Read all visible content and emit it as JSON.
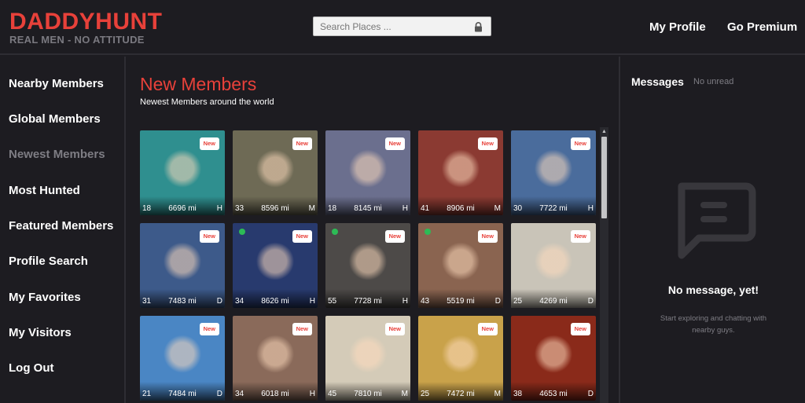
{
  "header": {
    "logo": "DADDYHUNT",
    "tagline": "REAL MEN - NO ATTITUDE",
    "search_placeholder": "Search Places ...",
    "lock_icon": "lock-icon",
    "nav": [
      "My Profile",
      "Go Premium"
    ]
  },
  "sidebar": {
    "items": [
      {
        "label": "Nearby Members",
        "active": false
      },
      {
        "label": "Global Members",
        "active": false
      },
      {
        "label": "Newest Members",
        "active": true
      },
      {
        "label": "Most Hunted",
        "active": false
      },
      {
        "label": "Featured Members",
        "active": false
      },
      {
        "label": "Profile Search",
        "active": false
      },
      {
        "label": "My Favorites",
        "active": false
      },
      {
        "label": "My Visitors",
        "active": false
      },
      {
        "label": "Log Out",
        "active": false
      }
    ]
  },
  "main": {
    "title": "New Members",
    "subtitle": "Newest Members around the world",
    "badge_label": "New",
    "members": [
      {
        "age": "18",
        "distance": "6696 mi",
        "tag": "H",
        "online": false,
        "bg": "#2f8f8f"
      },
      {
        "age": "33",
        "distance": "8596 mi",
        "tag": "M",
        "online": false,
        "bg": "#6e6a55"
      },
      {
        "age": "18",
        "distance": "8145 mi",
        "tag": "H",
        "online": false,
        "bg": "#6b6f8e"
      },
      {
        "age": "41",
        "distance": "8906 mi",
        "tag": "M",
        "online": false,
        "bg": "#8b3a32"
      },
      {
        "age": "30",
        "distance": "7722 mi",
        "tag": "H",
        "online": false,
        "bg": "#4a6c9c"
      },
      {
        "age": "31",
        "distance": "7483 mi",
        "tag": "D",
        "online": false,
        "bg": "#3d5a8a"
      },
      {
        "age": "34",
        "distance": "8626 mi",
        "tag": "H",
        "online": true,
        "bg": "#283a6e"
      },
      {
        "age": "55",
        "distance": "7728 mi",
        "tag": "H",
        "online": true,
        "bg": "#4d4a48"
      },
      {
        "age": "43",
        "distance": "5519 mi",
        "tag": "D",
        "online": true,
        "bg": "#8a6450"
      },
      {
        "age": "25",
        "distance": "4269 mi",
        "tag": "D",
        "online": false,
        "bg": "#c9c4b8"
      },
      {
        "age": "21",
        "distance": "7484 mi",
        "tag": "D",
        "online": false,
        "bg": "#4a86c4"
      },
      {
        "age": "34",
        "distance": "6018 mi",
        "tag": "H",
        "online": false,
        "bg": "#8a6a5a"
      },
      {
        "age": "45",
        "distance": "7810 mi",
        "tag": "M",
        "online": false,
        "bg": "#d4cbb8"
      },
      {
        "age": "25",
        "distance": "7472 mi",
        "tag": "M",
        "online": false,
        "bg": "#c9a24a"
      },
      {
        "age": "38",
        "distance": "4653 mi",
        "tag": "D",
        "online": false,
        "bg": "#8a2a1a"
      }
    ]
  },
  "messages": {
    "title": "Messages",
    "unread": "No unread",
    "empty_title": "No message, yet!",
    "empty_text": "Start exploring and chatting with nearby guys.",
    "empty_icon": "chat-bubble-icon"
  },
  "colors": {
    "accent": "#e8413a",
    "background": "#1d1c21",
    "online": "#2dbb56"
  }
}
